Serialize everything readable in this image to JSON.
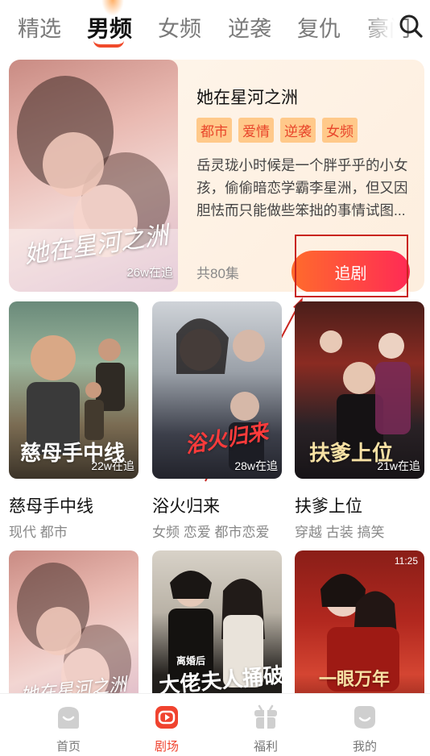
{
  "tabs": {
    "items": [
      "精选",
      "男频",
      "女频",
      "逆袭",
      "复仇",
      "豪门"
    ],
    "active_index": 1
  },
  "featured": {
    "title": "她在星河之洲",
    "tags": [
      "都市",
      "爱情",
      "逆袭",
      "女频"
    ],
    "description": "岳灵珑小时候是一个胖乎乎的小女孩，偷偷暗恋学霸李星洲，但又因胆怯而只能做些笨拙的事情试图...",
    "episodes": "共80集",
    "views": "26w在追",
    "poster_title": "她在星河之洲",
    "follow_label": "追剧"
  },
  "grid": [
    {
      "title": "慈母手中线",
      "subtitle": "现代 都市",
      "views": "22w在追",
      "poster_text": "慈母手中线"
    },
    {
      "title": "浴火归来",
      "subtitle": "女频 恋爱 都市恋爱",
      "views": "28w在追",
      "poster_text": "浴火归来"
    },
    {
      "title": "扶爹上位",
      "subtitle": "穿越 古装 搞笑",
      "views": "21w在追",
      "poster_text": "扶爹上位"
    },
    {
      "title": "",
      "subtitle": "",
      "views": "",
      "poster_text": "她在星河之洲"
    },
    {
      "title": "",
      "subtitle": "",
      "views": "",
      "poster_text": "大佬夫人捅破天"
    },
    {
      "title": "",
      "subtitle": "",
      "views": "",
      "poster_text": "一眼万年"
    }
  ],
  "status_time": "11:25",
  "bottom_nav": {
    "items": [
      {
        "label": "首页",
        "icon": "home-icon"
      },
      {
        "label": "剧场",
        "icon": "theater-icon"
      },
      {
        "label": "福利",
        "icon": "gift-icon"
      },
      {
        "label": "我的",
        "icon": "profile-icon"
      }
    ],
    "active_index": 1
  },
  "colors": {
    "accent": "#f0432f",
    "tag_bg": "#ffc98a",
    "tag_text": "#e8452a"
  }
}
